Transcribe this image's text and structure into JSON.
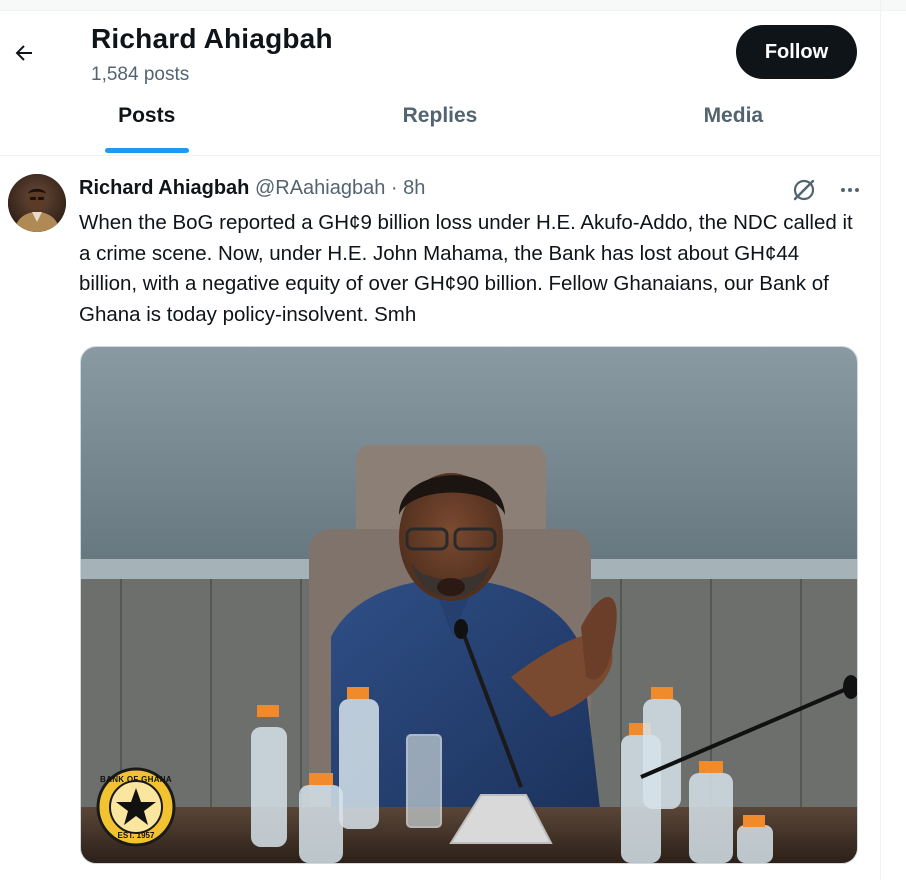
{
  "header": {
    "title": "Richard Ahiagbah",
    "subtitle": "1,584 posts",
    "follow_label": "Follow"
  },
  "tabs": [
    {
      "label": "Posts",
      "active": true
    },
    {
      "label": "Replies",
      "active": false
    },
    {
      "label": "Media",
      "active": false
    }
  ],
  "post": {
    "author_name": "Richard Ahiagbah",
    "handle": "@RAahiagbah",
    "separator": "·",
    "time": "8h",
    "text": "When the BoG reported a GH¢9 billion loss under H.E. Akufo-Addo, the NDC called it a crime scene. Now, under H.E. John Mahama, the Bank has lost about GH¢44 billion, with a negative equity of over GH¢90 billion. Fellow Ghanaians, our Bank of Ghana is today policy-insolvent. Smh",
    "media": {
      "logo_text_top": "BANK OF GHANA",
      "logo_text_bottom": "EST. 1957"
    }
  },
  "icons": [
    "arrow-left-icon",
    "grok-icon",
    "more-icon"
  ],
  "colors": {
    "accent": "#1d9bf0",
    "text": "#0f1419",
    "muted": "#536471",
    "button": "#0f1419"
  }
}
